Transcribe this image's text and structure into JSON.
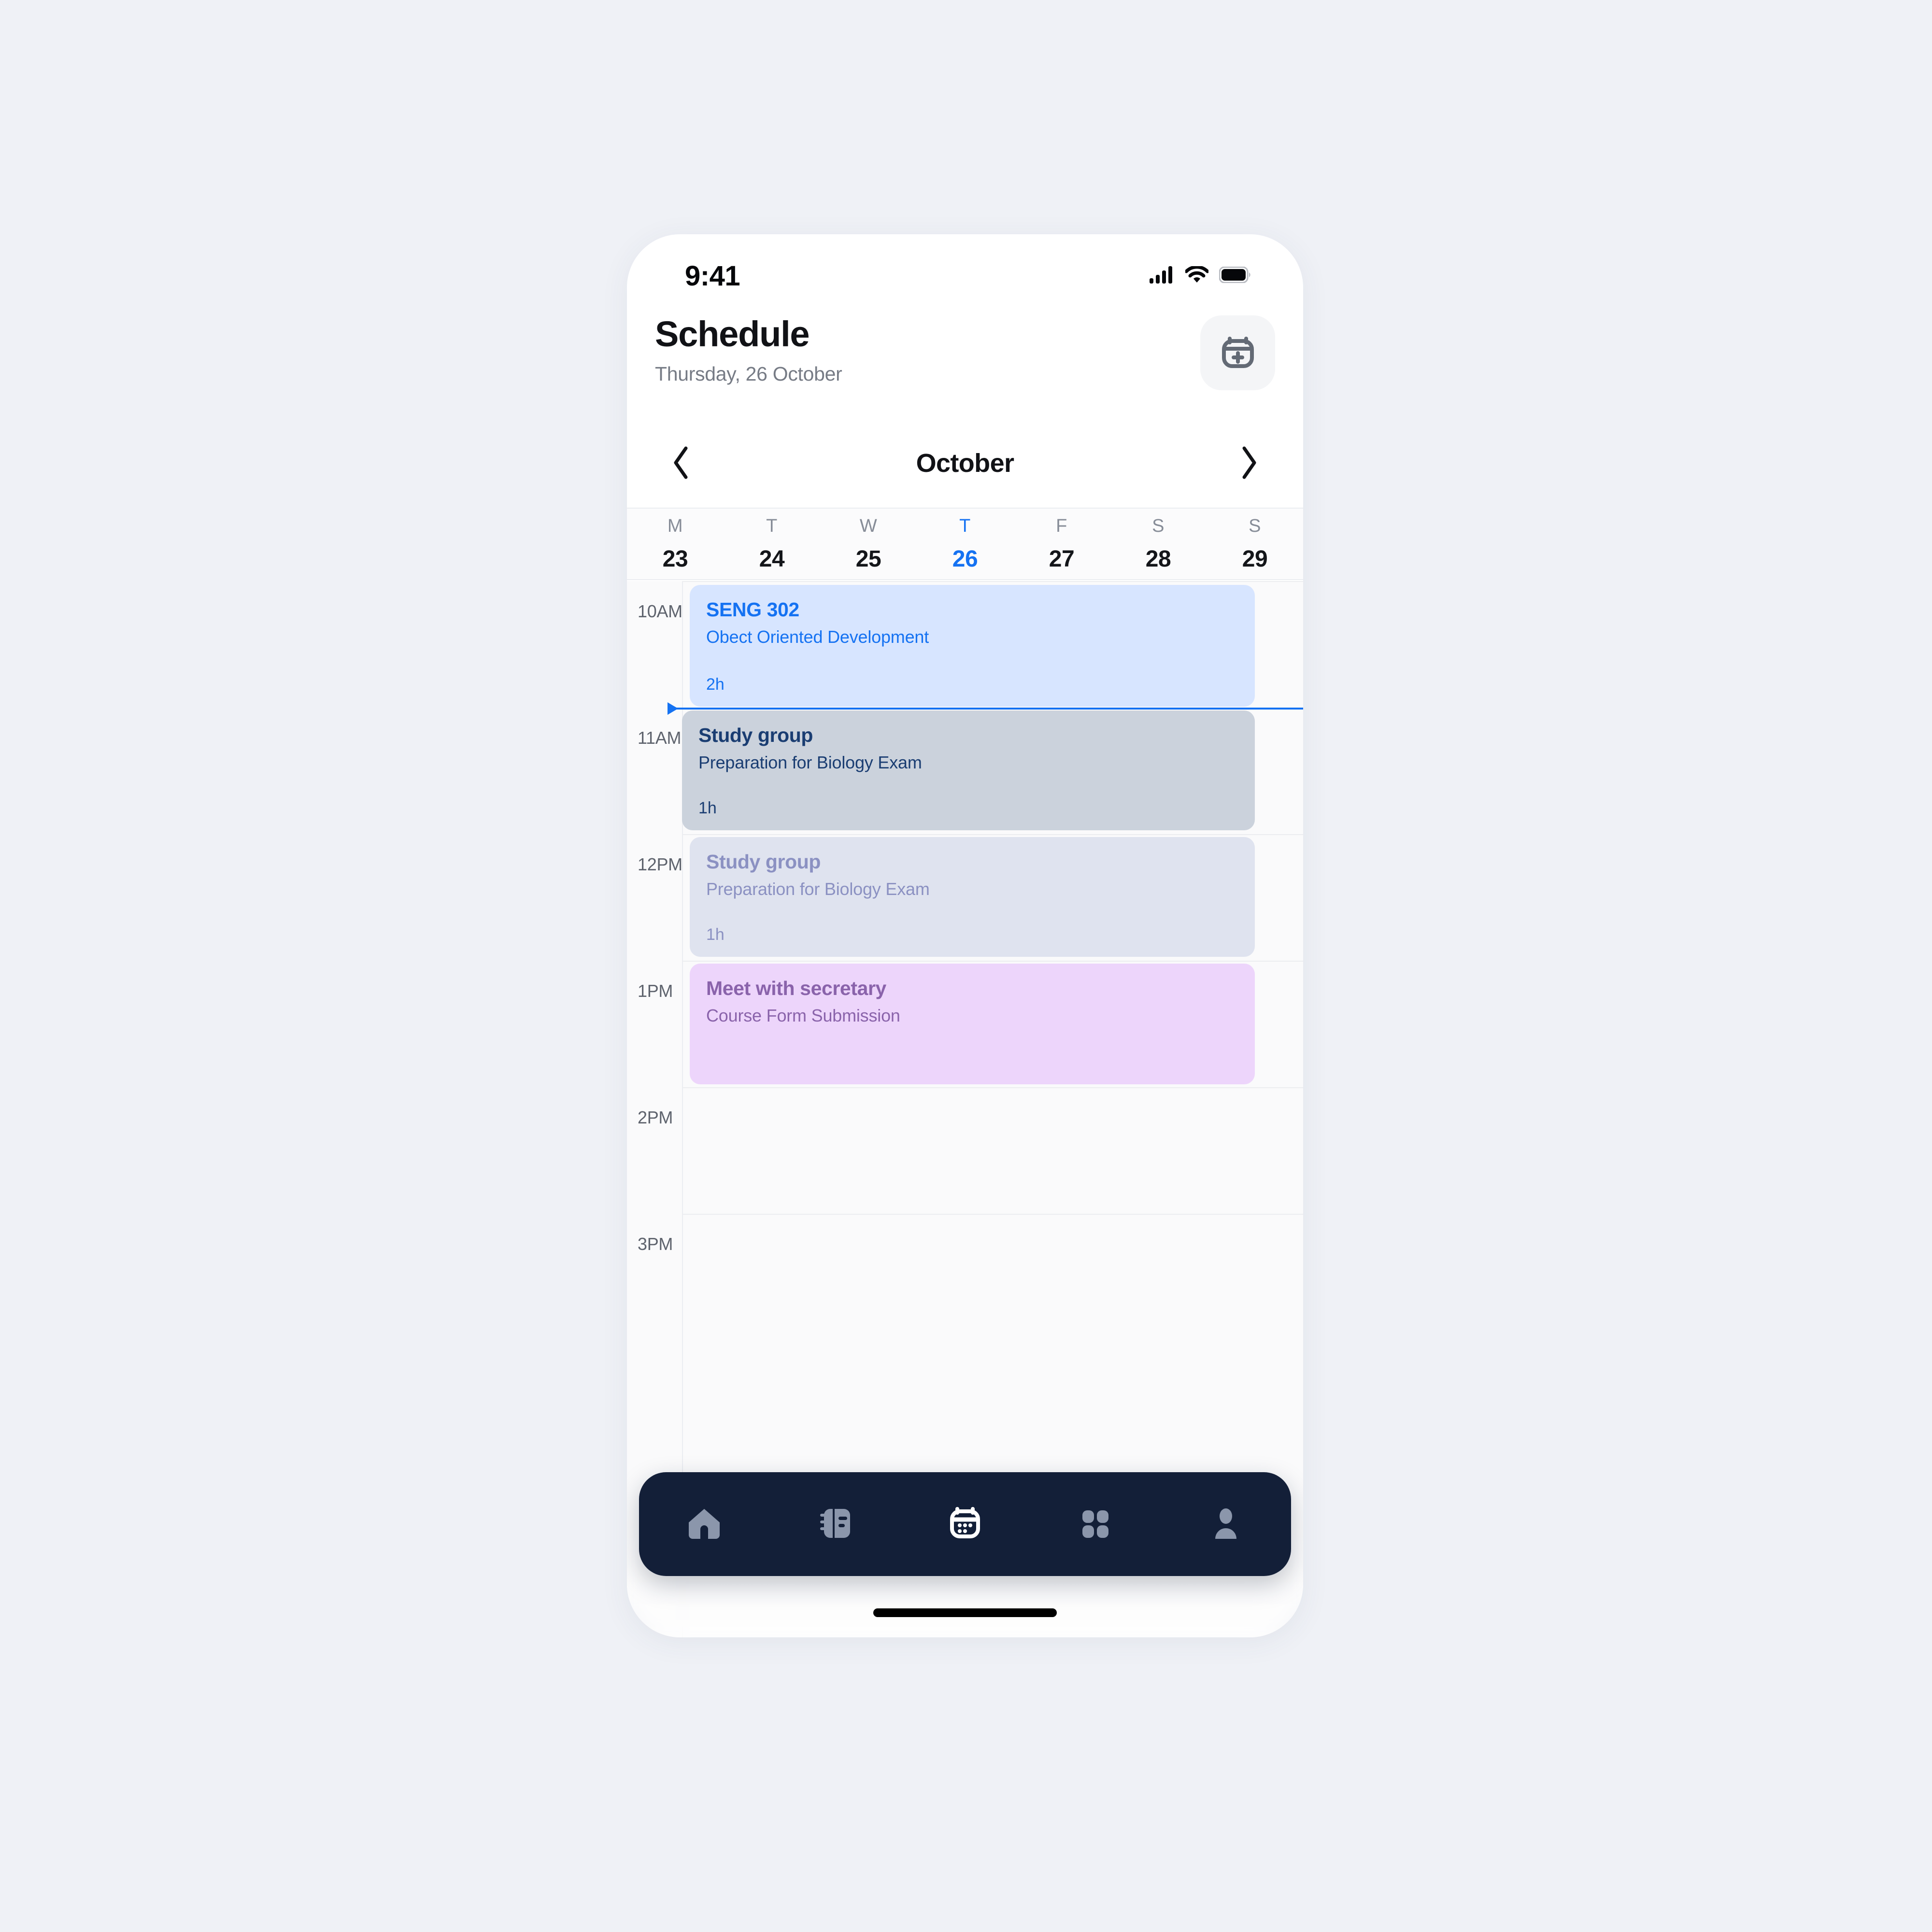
{
  "status_bar": {
    "time": "9:41",
    "icons": [
      "cellular-signal-icon",
      "wifi-icon",
      "battery-icon"
    ]
  },
  "header": {
    "title": "Schedule",
    "subtitle": "Thursday, 26 October",
    "add_button_icon": "calendar-plus-icon"
  },
  "month_nav": {
    "prev_icon": "chevron-left-icon",
    "next_icon": "chevron-right-icon",
    "month": "October"
  },
  "week_strip": {
    "days": [
      {
        "letter": "M",
        "num": "23",
        "active": false
      },
      {
        "letter": "T",
        "num": "24",
        "active": false
      },
      {
        "letter": "W",
        "num": "25",
        "active": false
      },
      {
        "letter": "T",
        "num": "26",
        "active": true
      },
      {
        "letter": "F",
        "num": "27",
        "active": false
      },
      {
        "letter": "S",
        "num": "28",
        "active": false
      },
      {
        "letter": "S",
        "num": "29",
        "active": false
      }
    ],
    "active_color": "#1572f2"
  },
  "timeline": {
    "hours": [
      "10AM",
      "11AM",
      "12PM",
      "1PM",
      "2PM",
      "3PM"
    ],
    "now_indicator_color": "#1572f2",
    "events": [
      {
        "title": "SENG 302",
        "subtitle": "Obect Oriented Development",
        "duration": "2h",
        "color": "#d7e5ff",
        "text_color": "#1572f2",
        "style": "blue"
      },
      {
        "title": "Study group",
        "subtitle": "Preparation for Biology Exam",
        "duration": "1h",
        "color": "#cbd2dc",
        "text_color": "#1a3d72",
        "style": "gray"
      },
      {
        "title": "Study group",
        "subtitle": "Preparation for Biology Exam",
        "duration": "1h",
        "color": "#dfe3ef",
        "text_color": "#8b91c2",
        "style": "ghost"
      },
      {
        "title": "Meet with secretary",
        "subtitle": "Course Form Submission",
        "duration": "",
        "color": "#edd5fb",
        "text_color": "#8a63ab",
        "style": "pink"
      }
    ]
  },
  "bottom_nav": {
    "background": "#131f38",
    "items": [
      {
        "icon": "home-icon",
        "active": false
      },
      {
        "icon": "notebook-icon",
        "active": false
      },
      {
        "icon": "calendar-icon",
        "active": true
      },
      {
        "icon": "grid-icon",
        "active": false
      },
      {
        "icon": "person-icon",
        "active": false
      }
    ]
  }
}
